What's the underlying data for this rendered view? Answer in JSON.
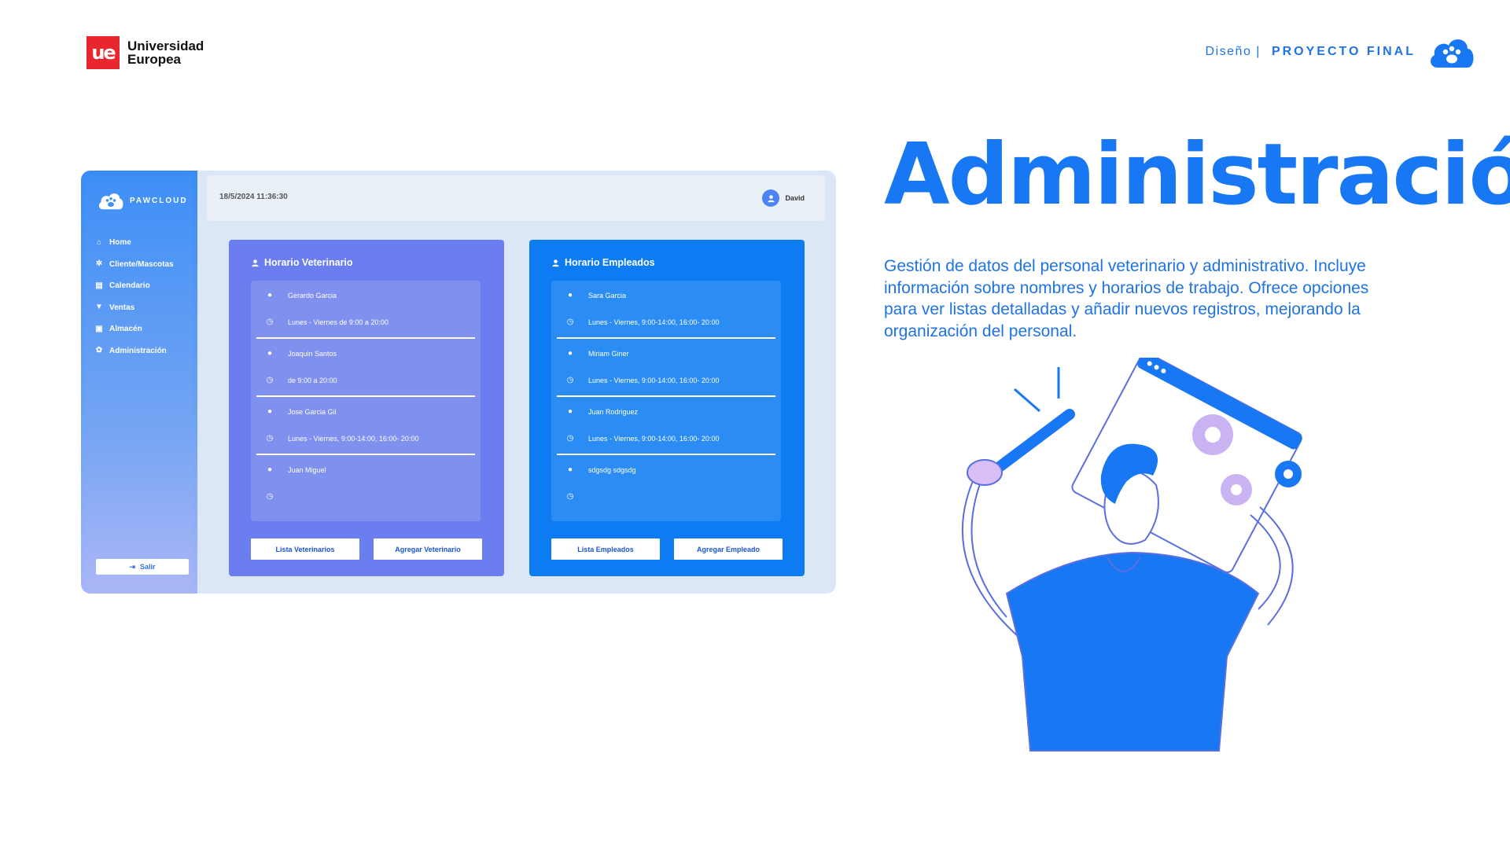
{
  "logo": {
    "line1": "Universidad",
    "line2": "Europea",
    "mark": "ue"
  },
  "header": {
    "crumb": "Diseño |",
    "project": "PROYECTO FINAL",
    "icon": "cloud-paw-icon"
  },
  "app": {
    "brand": "PAWCLOUD",
    "datetime": "18/5/2024 11:36:30",
    "user": "David",
    "nav": [
      {
        "label": "Home",
        "icon": "home-icon"
      },
      {
        "label": "Cliente/Mascotas",
        "icon": "paw-icon"
      },
      {
        "label": "Calendario",
        "icon": "calendar-icon"
      },
      {
        "label": "Ventas",
        "icon": "cart-icon"
      },
      {
        "label": "Almacén",
        "icon": "box-icon"
      },
      {
        "label": "Administración",
        "icon": "gear-icon"
      }
    ],
    "logout": "Salir",
    "vet": {
      "title": "Horario Veterinario",
      "entries": [
        {
          "name": "Gerardo Garcia",
          "schedule": "Lunes - Viernes de 9:00 a 20:00"
        },
        {
          "name": "Joaquin Santos",
          "schedule": "de 9:00 a 20:00"
        },
        {
          "name": "Jose Garcia Gil",
          "schedule": "Lunes - Viernes, 9:00-14:00, 16:00- 20:00"
        },
        {
          "name": "Juan Miguel",
          "schedule": ""
        }
      ],
      "btn_list": "Lista Veterinarios",
      "btn_add": "Agregar Veterinario"
    },
    "emp": {
      "title": "Horario Empleados",
      "entries": [
        {
          "name": "Sara Garcia",
          "schedule": "Lunes - Viernes, 9:00-14:00, 16:00- 20:00"
        },
        {
          "name": "Miriam Giner",
          "schedule": "Lunes - Viernes, 9:00-14:00, 16:00- 20:00"
        },
        {
          "name": "Juan Rodriguez",
          "schedule": "Lunes - Viernes, 9:00-14:00, 16:00- 20:00"
        },
        {
          "name": "sdgsdg sdgsdg",
          "schedule": ""
        }
      ],
      "btn_list": "Lista Empleados",
      "btn_add": "Agregar Empleado"
    }
  },
  "heading": "Administración",
  "description": "Gestión de datos del personal veterinario y administrativo. Incluye información sobre nombres y horarios de trabajo. Ofrece opciones para ver listas detalladas y añadir nuevos registros, mejorando la organización del personal.",
  "colors": {
    "accent": "#1877f2",
    "vet_panel": "#6b7ef0",
    "emp_panel": "#0d7cf2",
    "ue_red": "#e8262d"
  }
}
